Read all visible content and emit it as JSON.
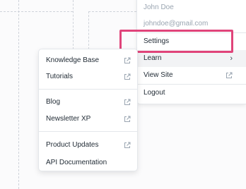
{
  "account_menu": {
    "name": "John Doe",
    "email": "johndoe@gmail.com",
    "items": {
      "settings": "Settings",
      "learn": "Learn",
      "view_site": "View Site",
      "logout": "Logout"
    },
    "learn_chevron": "›"
  },
  "learn_submenu": {
    "items": [
      {
        "label": "Knowledge Base",
        "icon": "external-link-icon"
      },
      {
        "label": "Tutorials",
        "icon": "external-link-icon"
      },
      {
        "label": "Blog",
        "icon": "external-link-icon"
      },
      {
        "label": "Newsletter XP",
        "icon": "external-link-icon"
      },
      {
        "label": "Product Updates",
        "icon": "external-link-icon"
      },
      {
        "label": "API Documentation",
        "icon": null
      }
    ]
  },
  "colors": {
    "highlight": "#e0447a",
    "hover_bg": "#f2f3f5",
    "muted_text": "#9aa5b1"
  }
}
